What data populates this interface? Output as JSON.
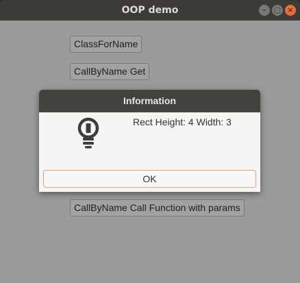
{
  "window": {
    "title": "OOP demo",
    "controls": {
      "minimize": "–",
      "maximize": "□",
      "close": "×"
    }
  },
  "buttons": {
    "class_for_name": "ClassForName",
    "call_by_name_get": "CallByName Get",
    "call_by_name_call_params": "CallByName Call Function with params"
  },
  "dialog": {
    "title": "Information",
    "icon": "lightbulb-icon",
    "message": "Rect Height: 4 Width: 3",
    "ok_label": "OK"
  },
  "colors": {
    "titlebar": "#3c3b37",
    "close_button": "#ec6b3a",
    "ok_focus_border": "#e8a080"
  }
}
